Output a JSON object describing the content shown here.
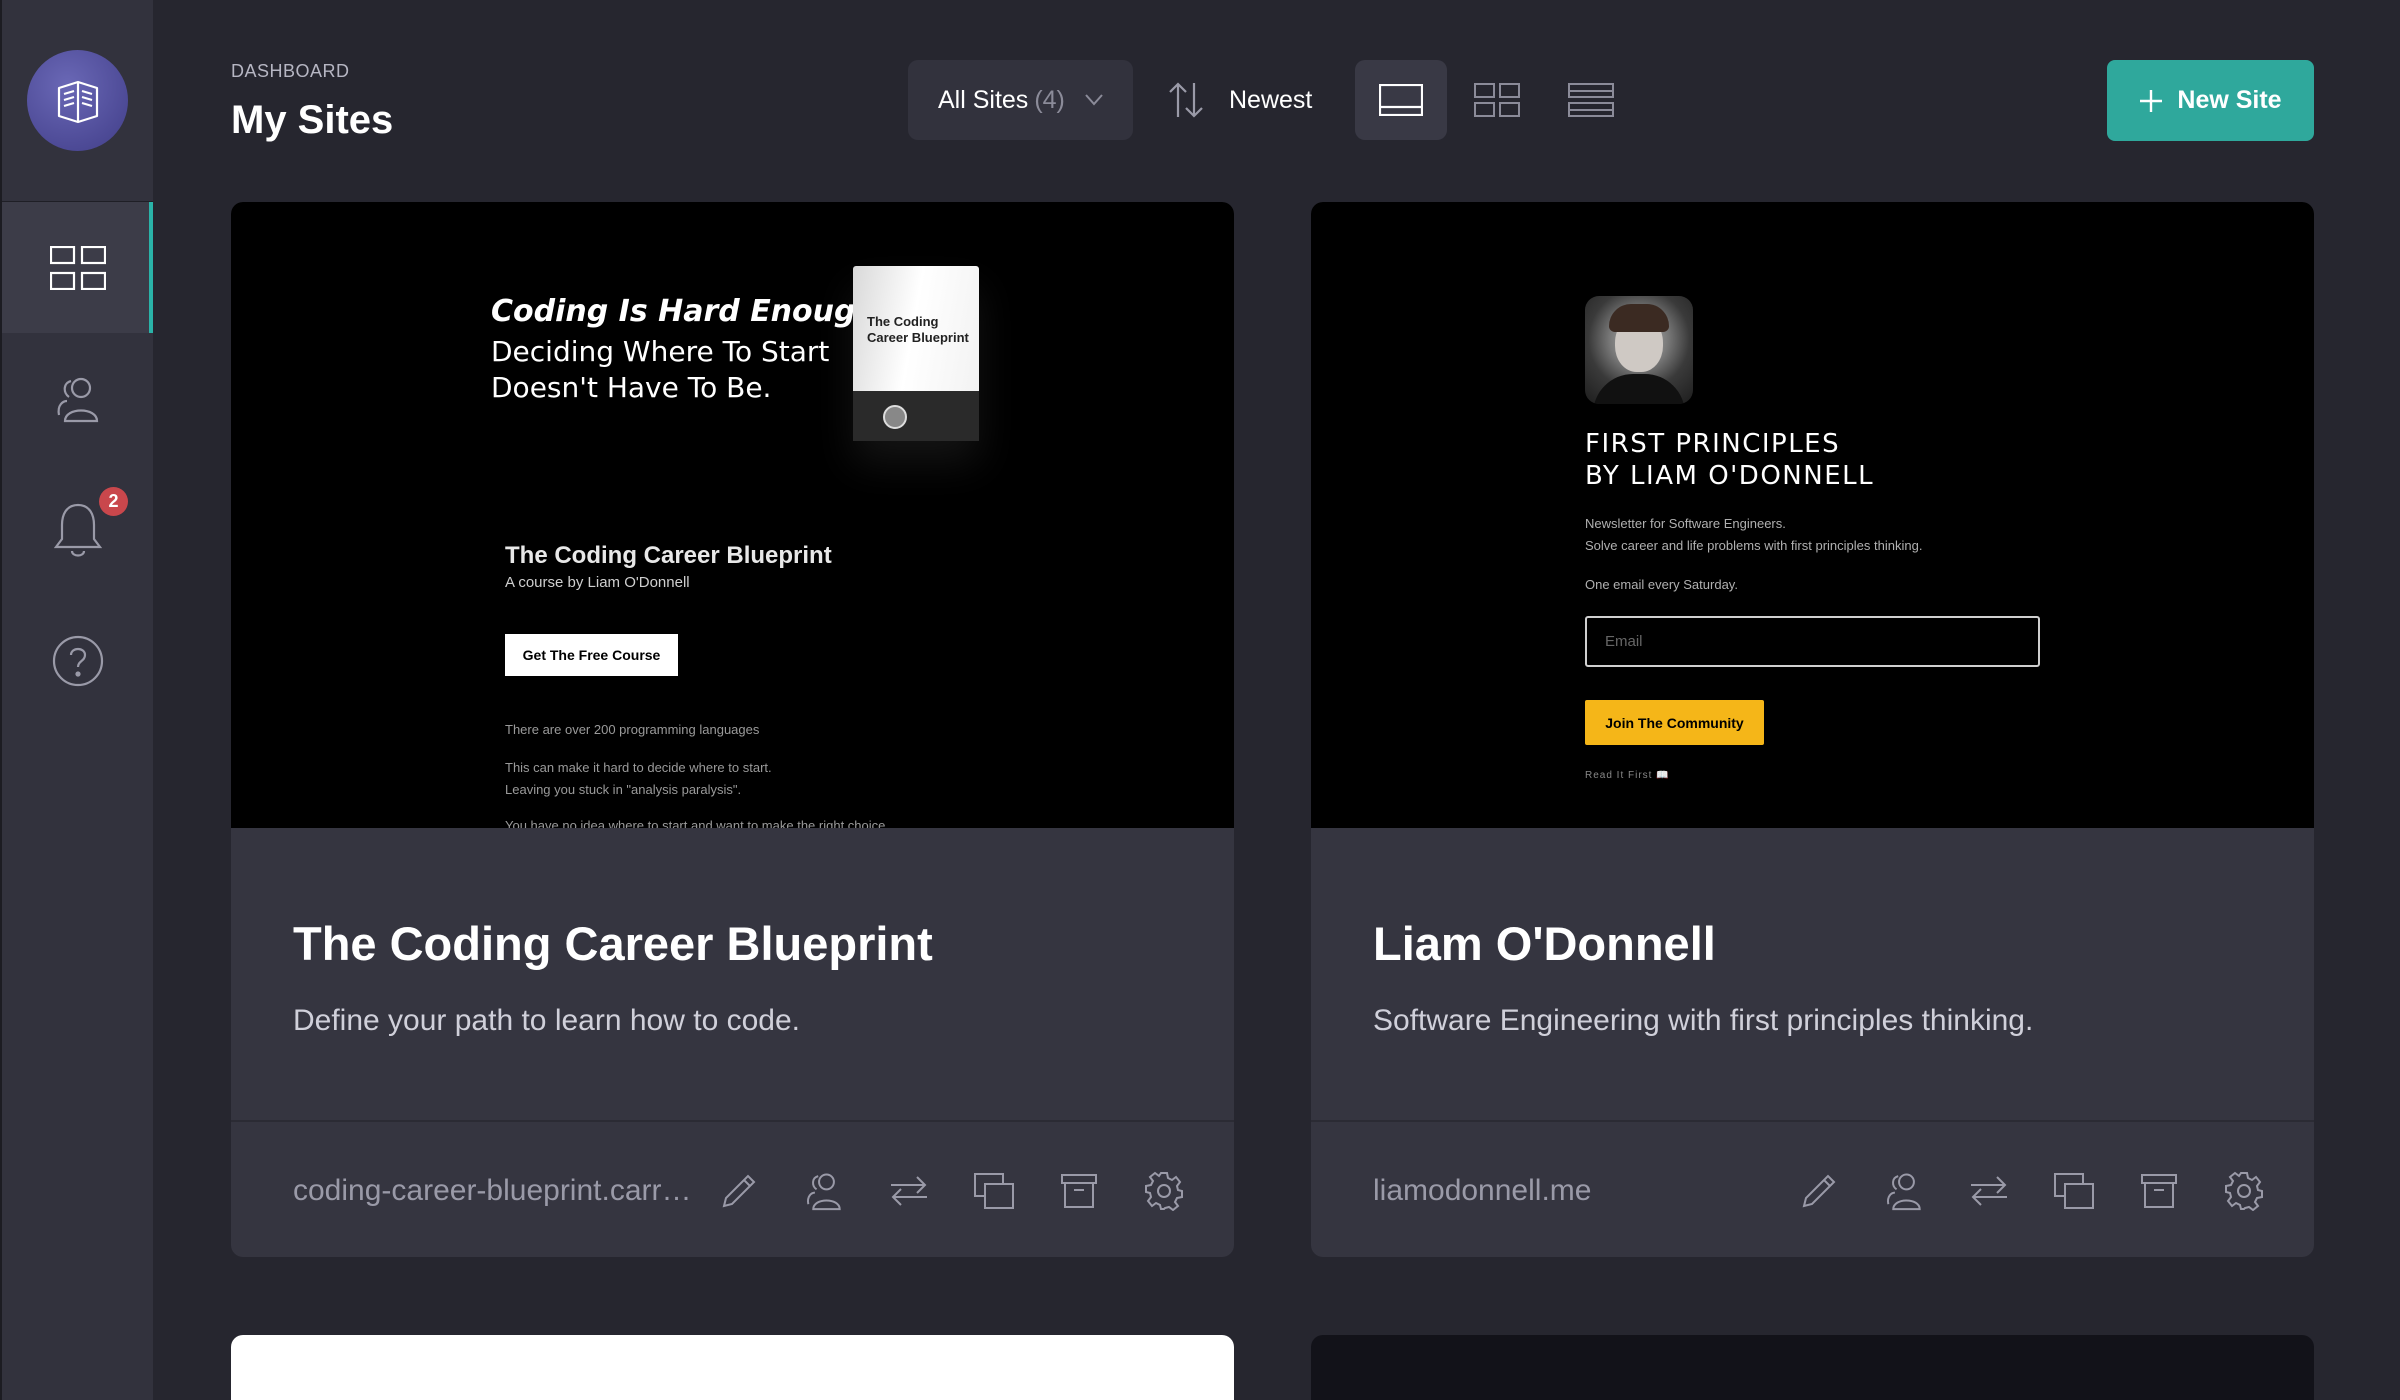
{
  "header": {
    "eyebrow": "DASHBOARD",
    "title": "My Sites",
    "filter_label": "All Sites",
    "filter_count": "(4)",
    "sort_label": "Newest",
    "new_site_label": "New Site"
  },
  "sidebar": {
    "notifications_badge": "2"
  },
  "sites": [
    {
      "title": "The Coding Career Blueprint",
      "description": "Define your path to learn how to code.",
      "domain": "coding-career-blueprint.carrd.co",
      "preview": {
        "headline_bold": "Coding Is Hard Enough.",
        "headline": "Deciding Where To Start Doesn't Have To Be.",
        "box_text": "The Coding Career Blueprint",
        "course_title": "The Coding Career Blueprint",
        "course_by": "A course by Liam O'Donnell",
        "cta": "Get The Free Course",
        "line1": "There are over 200 programming languages",
        "line2": "This can make it hard to decide where to start.",
        "line3": "Leaving you stuck in \"analysis paralysis\".",
        "line4": "You have no idea where to start and want to make the right choice"
      }
    },
    {
      "title": "Liam O'Donnell",
      "description": "Software Engineering with first principles thinking.",
      "domain": "liamodonnell.me",
      "preview": {
        "title_line1": "FIRST PRINCIPLES",
        "title_line2": "BY LIAM O'DONNELL",
        "sub1": "Newsletter for Software Engineers.",
        "sub2": "Solve career and life problems with first principles thinking.",
        "sub3": "One email every Saturday.",
        "email_placeholder": "Email",
        "cta": "Join The Community",
        "read_first": "Read It First 📖"
      }
    }
  ],
  "colors": {
    "accent": "#2fa89c",
    "background": "#26262f",
    "sidebar": "#32323d",
    "card": "#353540",
    "badge": "#c9474c",
    "cta_yellow": "#f5b618"
  }
}
